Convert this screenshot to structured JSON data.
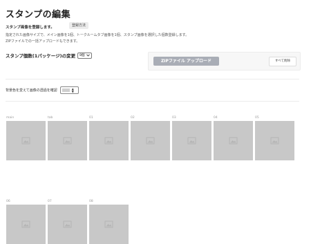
{
  "header": {
    "title": "スタンプの編集",
    "subtitle": "スタンプ画像を登録します。",
    "help_label": "登録方法",
    "description_line1": "指定された画像サイズで、メイン画像を1個、トークルームタブ画像を1個、スタンプ画像を選択した個数登録します。",
    "description_line2": "ZIPファイルでの一括アップロードもできます。"
  },
  "count": {
    "label": "スタンプ個数(1パッケージ)の変更",
    "selected": "8個"
  },
  "upload": {
    "zip_label": "ZIPファイル アップロード",
    "delete_all_label": "すべて削除"
  },
  "background": {
    "label": "背景色を変えて画像の透過を確認",
    "swatch_color": "#cfcfcf"
  },
  "slots": [
    {
      "label": "main",
      "icon": "image-placeholder-icon"
    },
    {
      "label": "tab",
      "icon": "image-placeholder-icon"
    },
    {
      "label": "01",
      "icon": "image-placeholder-icon"
    },
    {
      "label": "02",
      "icon": "image-placeholder-icon"
    },
    {
      "label": "03",
      "icon": "image-placeholder-icon"
    },
    {
      "label": "04",
      "icon": "image-placeholder-icon"
    },
    {
      "label": "05",
      "icon": "image-placeholder-icon"
    },
    {
      "label": "06",
      "icon": "image-placeholder-icon"
    },
    {
      "label": "07",
      "icon": "image-placeholder-icon"
    },
    {
      "label": "08",
      "icon": "image-placeholder-icon"
    }
  ],
  "colors": {
    "zip_button": "#a9adb6",
    "slot_background": "#c8c8c8"
  }
}
